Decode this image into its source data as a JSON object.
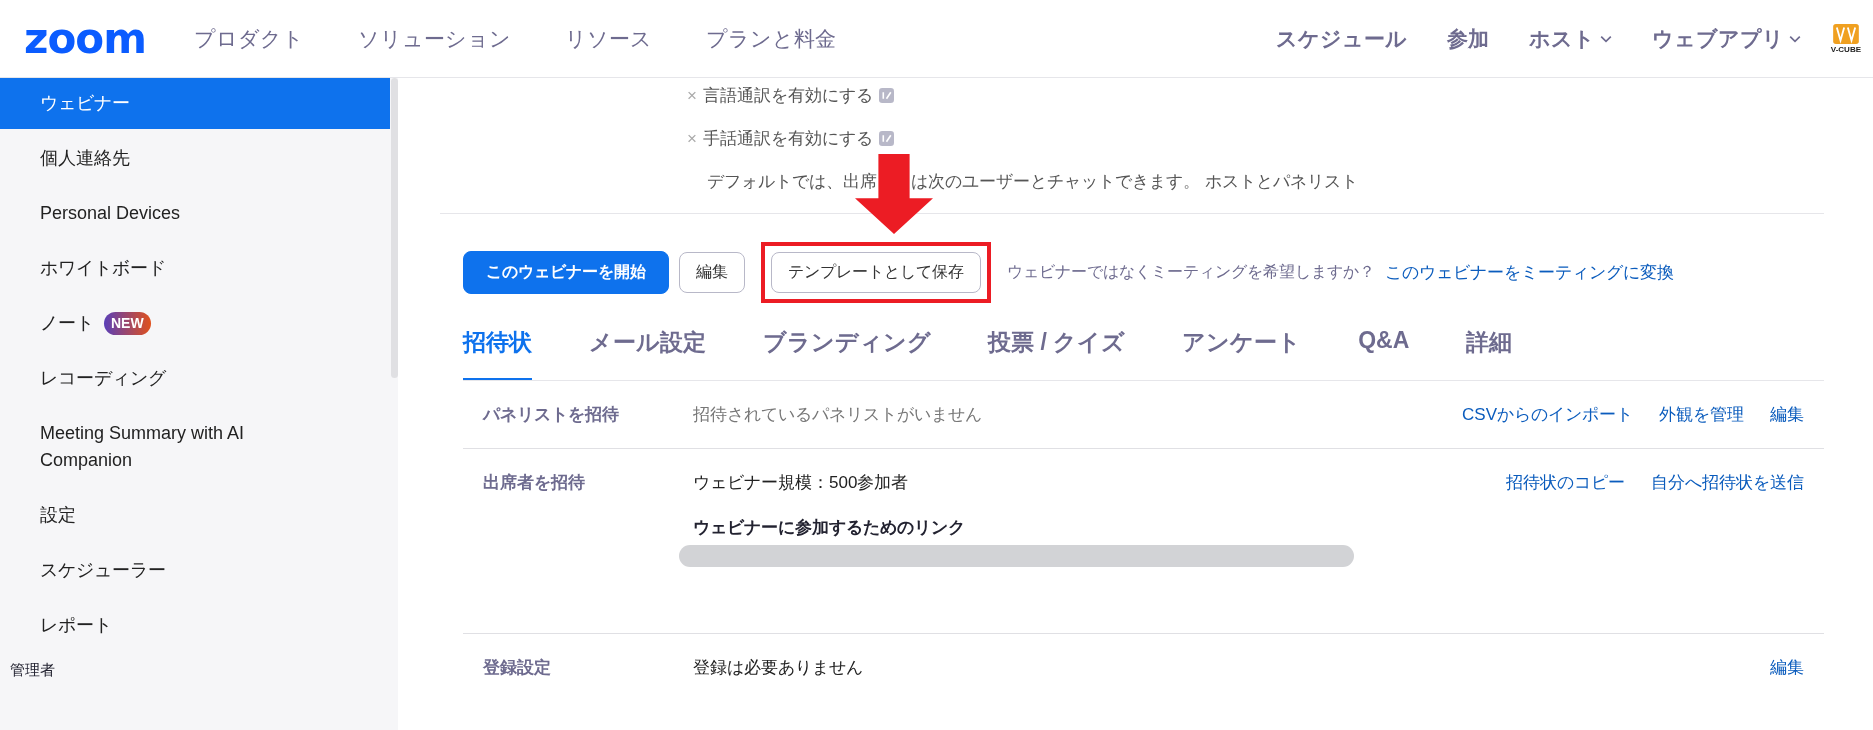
{
  "header": {
    "logo": "zoom",
    "nav": [
      "プロダクト",
      "ソリューション",
      "リソース",
      "プランと料金"
    ],
    "nav_right": [
      {
        "label": "スケジュール",
        "dropdown": false
      },
      {
        "label": "参加",
        "dropdown": false
      },
      {
        "label": "ホスト",
        "dropdown": true
      },
      {
        "label": "ウェブアプリ",
        "dropdown": true
      }
    ],
    "partner_logo": "V-CUBE"
  },
  "sidebar": {
    "items": [
      {
        "label": "ウェビナー",
        "selected": true
      },
      {
        "label": "個人連絡先",
        "selected": false
      },
      {
        "label": "Personal Devices",
        "selected": false
      },
      {
        "label": "ホワイトボード",
        "selected": false
      },
      {
        "label": "ノート",
        "selected": false,
        "badge": "NEW"
      },
      {
        "label": "レコーディング",
        "selected": false
      },
      {
        "label": "Meeting Summary with AI Companion",
        "selected": false
      },
      {
        "label": "設定",
        "selected": false
      },
      {
        "label": "スケジューラー",
        "selected": false
      },
      {
        "label": "レポート",
        "selected": false
      }
    ],
    "section": "管理者"
  },
  "settings": [
    {
      "mark": "×",
      "label": "言語通訳を有効にする",
      "enabled": false
    },
    {
      "mark": "×",
      "label": "手話通訳を有効にする",
      "enabled": false
    }
  ],
  "chat_note": [
    "デフォルトでは、出席",
    "は次のユーザーとチャットできます。 ホストとパネリスト"
  ],
  "actions": {
    "buttons": [
      {
        "label": "このウェビナーを開始",
        "kind": "primary",
        "highlighted": false
      },
      {
        "label": "編集",
        "kind": "secondary",
        "highlighted": false
      },
      {
        "label": "テンプレートとして保存",
        "kind": "secondary",
        "highlighted": true
      }
    ],
    "question": "ウェビナーではなくミーティングを希望しますか？",
    "link": "このウェビナーをミーティングに変換"
  },
  "tabs": [
    {
      "label": "招待状",
      "selected": true
    },
    {
      "label": "メール設定",
      "selected": false
    },
    {
      "label": "ブランディング",
      "selected": false
    },
    {
      "label": "投票 / クイズ",
      "selected": false
    },
    {
      "label": "アンケート",
      "selected": false
    },
    {
      "label": "Q&A",
      "selected": false
    },
    {
      "label": "詳細",
      "selected": false
    }
  ],
  "rows": [
    {
      "label": "パネリストを招待",
      "value": "招待されているパネリストがいません",
      "muted": true,
      "links": [
        "CSVからのインポート",
        "外観を管理",
        "編集"
      ]
    },
    {
      "label": "出席者を招待",
      "value": "ウェビナー規模：500参加者",
      "muted": false,
      "subheading": "ウェビナーに参加するためのリンク",
      "redacted_link": true,
      "links": [
        "招待状のコピー",
        "自分へ招待状を送信"
      ]
    },
    {
      "label": "登録設定",
      "value": "登録は必要ありません",
      "muted": false,
      "links": [
        "編集"
      ]
    }
  ]
}
